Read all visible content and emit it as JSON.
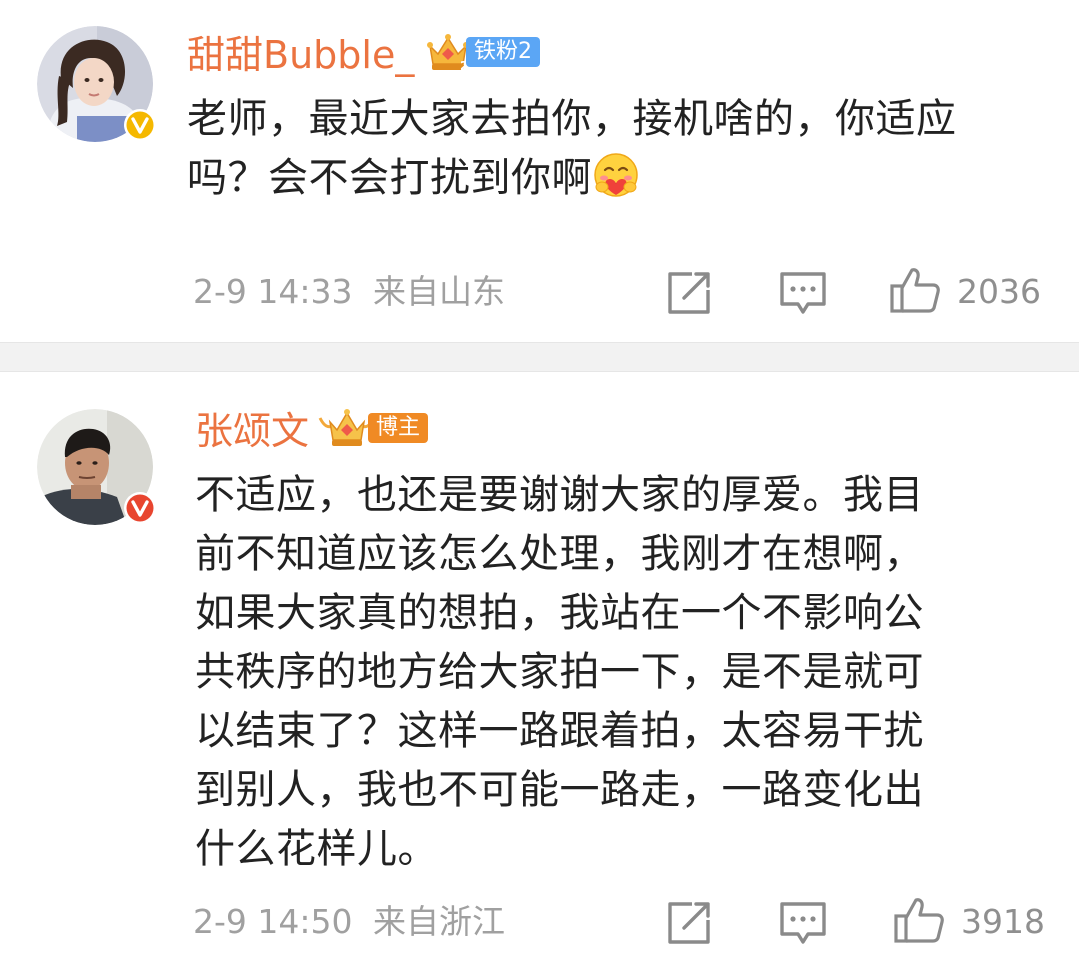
{
  "comments": [
    {
      "username": "甜甜Bubble_",
      "badge_label": "铁粉2",
      "content_lines": [
        "老师，最近大家去拍你，接机啥的，你适应",
        "吗？会不会打扰到你啊"
      ],
      "date": "2-9 14:33",
      "location": "来自山东",
      "likes": "2036",
      "badge_color": "#5ba6f5",
      "verify_color": "#f5b800"
    },
    {
      "username": "张颂文",
      "badge_label": "博主",
      "content_lines": [
        "不适应，也还是要谢谢大家的厚爱。我目",
        "前不知道应该怎么处理，我刚才在想啊，",
        "如果大家真的想拍，我站在一个不影响公",
        "共秩序的地方给大家拍一下，是不是就可",
        "以结束了？这样一路跟着拍，太容易干扰",
        "到别人，我也不可能一路走，一路变化出",
        "什么花样儿。"
      ],
      "date": "2-9 14:50",
      "location": "来自浙江",
      "likes": "3918",
      "badge_color": "#f08a24",
      "verify_color": "#e8452f"
    }
  ],
  "icons": {
    "share": "share-icon",
    "comment": "comment-icon",
    "like": "thumbs-up-icon",
    "emoji": "hugging-face-emoji"
  },
  "colors": {
    "username": "#eb7340",
    "meta": "#a0a0a0",
    "divider": "#f2f2f2"
  }
}
